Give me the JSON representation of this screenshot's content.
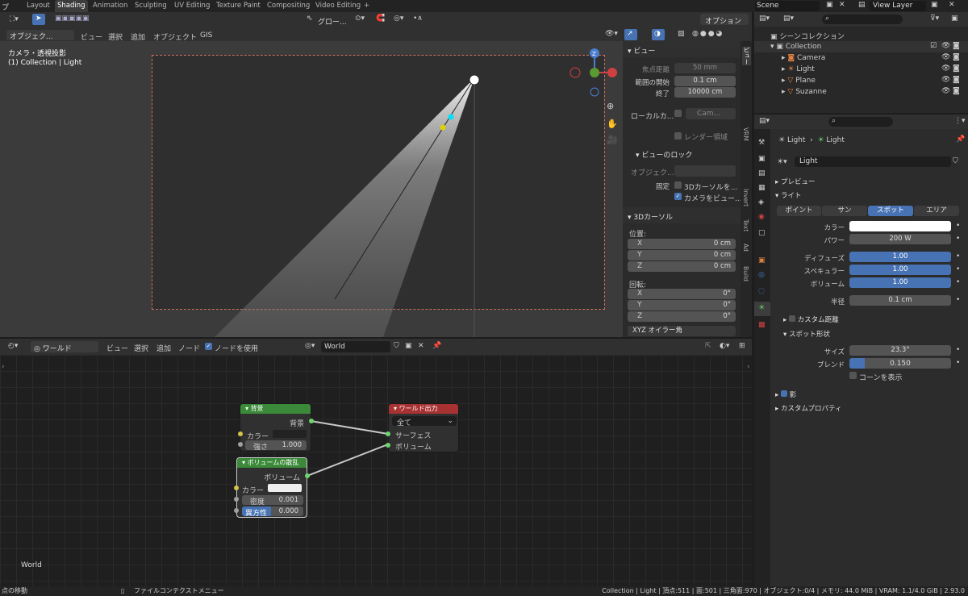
{
  "topbar": {
    "menu_fragment": "プ",
    "tabs": [
      "Layout",
      "Shading",
      "Animation",
      "Sculpting",
      "UV Editing",
      "Texture Paint",
      "Compositing",
      "Video Editing"
    ],
    "active_tab": "Shading",
    "add_tab": "+",
    "scene": "Scene",
    "view_layer": "View Layer"
  },
  "viewport_header": {
    "transform_orientation": "グロー...",
    "options": "オプション",
    "mode": "オブジェク...",
    "menus": [
      "ビュー",
      "選択",
      "追加",
      "オブジェクト",
      "GIS"
    ]
  },
  "viewport": {
    "view_name": "カメラ・透視投影",
    "collection_info": "(1) Collection | Light",
    "gizmo_z": "Z"
  },
  "npanel": {
    "view_section": "ビュー",
    "focal_label": "焦点距離",
    "focal_value": "50 mm",
    "clip_start_label": "範囲の開始",
    "clip_start_value": "0.1 cm",
    "clip_end_label": "終了",
    "clip_end_value": "10000 cm",
    "local_camera_label": "ローカルカ...",
    "local_camera_value": "Cam...",
    "render_region": "レンダー領域",
    "view_lock": "ビューのロック",
    "lock_object_label": "オブジェク...",
    "lock_label": "固定",
    "lock_3d_cursor": "3Dカーソルを...",
    "lock_camera": "カメラをビュー...",
    "cursor_section": "3Dカーソル",
    "location_label": "位置:",
    "loc_x_label": "X",
    "loc_x": "0 cm",
    "loc_y_label": "Y",
    "loc_y": "0 cm",
    "loc_z_label": "Z",
    "loc_z": "0 cm",
    "rotation_label": "回転:",
    "rot_x_label": "X",
    "rot_x": "0°",
    "rot_y_label": "Y",
    "rot_y": "0°",
    "rot_z_label": "Z",
    "rot_z": "0°",
    "rotation_mode": "XYZ オイラー角",
    "side_tabs": [
      "ビュー",
      "VRM",
      "Invert",
      "Text",
      "Ad",
      "Build"
    ]
  },
  "node_header": {
    "type": "ワールド",
    "menus": [
      "ビュー",
      "選択",
      "追加",
      "ノード"
    ],
    "use_nodes": "ノードを使用",
    "world_name": "World"
  },
  "nodes": {
    "background": {
      "title": "背景",
      "out": "背景",
      "color": "カラー",
      "strength_label": "強さ",
      "strength": "1.000"
    },
    "volume": {
      "title": "ボリュームの散乱",
      "out": "ボリューム",
      "color": "カラー",
      "density_label": "密度",
      "density": "0.001",
      "aniso_label": "異方性",
      "aniso": "0.000"
    },
    "output": {
      "title": "ワールド出力",
      "target": "全て",
      "surface": "サーフェス",
      "volume": "ボリューム"
    },
    "world_label": "World"
  },
  "outliner": {
    "scene_collection": "シーンコレクション",
    "items": [
      {
        "name": "Collection"
      },
      {
        "name": "Camera"
      },
      {
        "name": "Light"
      },
      {
        "name": "Plane"
      },
      {
        "name": "Suzanne"
      }
    ]
  },
  "properties": {
    "breadcrumb_object": "Light",
    "breadcrumb_data": "Light",
    "datablock": "Light",
    "preview": "プレビュー",
    "light_section": "ライト",
    "light_types": [
      "ポイント",
      "サン",
      "スポット",
      "エリア"
    ],
    "active_type": "スポット",
    "color_label": "カラー",
    "power_label": "パワー",
    "power": "200 W",
    "diffuse_label": "ディフューズ",
    "diffuse": "1.00",
    "specular_label": "スペキュラー",
    "specular": "1.00",
    "volume_label": "ボリューム",
    "volume": "1.00",
    "radius_label": "半径",
    "radius": "0.1 cm",
    "custom_distance": "カスタム距離",
    "spot_shape": "スポット形状",
    "size_label": "サイズ",
    "size": "23.3°",
    "blend_label": "ブレンド",
    "blend": "0.150",
    "blend_fraction": 0.15,
    "show_cone": "コーンを表示",
    "shadow": "影",
    "custom_props": "カスタムプロパティ"
  },
  "statusbar": {
    "left": "点の移動",
    "context_menu": "ファイルコンテクストメニュー",
    "stats": "Collection | Light | 頂点:511 | 面:501 | 三角面:970 | オブジェクト:0/4 | メモリ: 44.0 MiB | VRAM: 1.1/4.0 GiB | 2.93.0"
  },
  "colors": {
    "accent": "#4772b3",
    "bg_node_header": "#3a8a3a",
    "output_header": "#a83232",
    "light_color": "#ffffff"
  }
}
